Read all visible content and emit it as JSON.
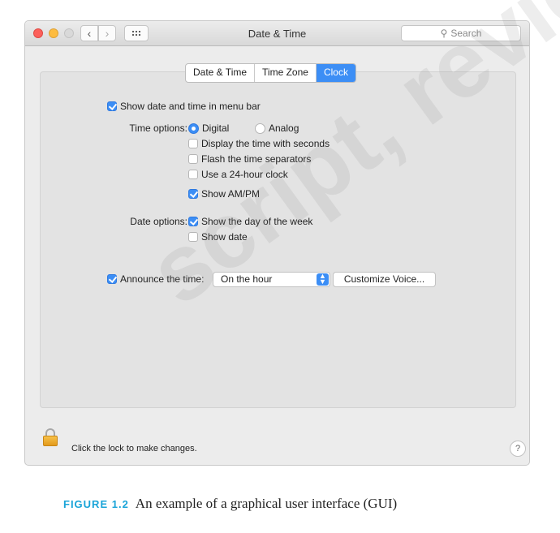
{
  "window": {
    "title": "Date & Time",
    "search_placeholder": "Search"
  },
  "tabs": [
    {
      "label": "Date & Time",
      "active": false
    },
    {
      "label": "Time Zone",
      "active": false
    },
    {
      "label": "Clock",
      "active": true
    }
  ],
  "clock": {
    "show_in_menu_bar": {
      "label": "Show date and time in menu bar",
      "checked": true
    },
    "time_options_label": "Time options:",
    "digital": {
      "label": "Digital",
      "selected": true
    },
    "analog": {
      "label": "Analog",
      "selected": false
    },
    "display_seconds": {
      "label": "Display the time with seconds",
      "checked": false
    },
    "flash_separators": {
      "label": "Flash the time separators",
      "checked": false
    },
    "use_24_hour": {
      "label": "Use a 24-hour clock",
      "checked": false
    },
    "show_ampm": {
      "label": "Show AM/PM",
      "checked": true
    },
    "date_options_label": "Date options:",
    "show_day_of_week": {
      "label": "Show the day of the week",
      "checked": true
    },
    "show_date": {
      "label": "Show date",
      "checked": false
    },
    "announce_time": {
      "label": "Announce the time:",
      "checked": true
    },
    "announce_interval": "On the hour",
    "customize_voice_label": "Customize Voice..."
  },
  "footer": {
    "lock_text": "Click the lock to make changes.",
    "help_label": "?"
  },
  "caption": {
    "figure_label": "FIGURE 1.2",
    "text": "An example of a graphical user interface (GUI)"
  },
  "watermark": "script, review only",
  "colors": {
    "accent": "#3c8ef5",
    "close": "#fc605b",
    "minimize": "#fdbc40",
    "caption_label": "#1aa4d8"
  },
  "icons": [
    "close-icon",
    "minimize-icon",
    "zoom-icon",
    "chevron-left-icon",
    "chevron-right-icon",
    "grid-icon",
    "search-icon",
    "lock-icon",
    "help-icon"
  ]
}
